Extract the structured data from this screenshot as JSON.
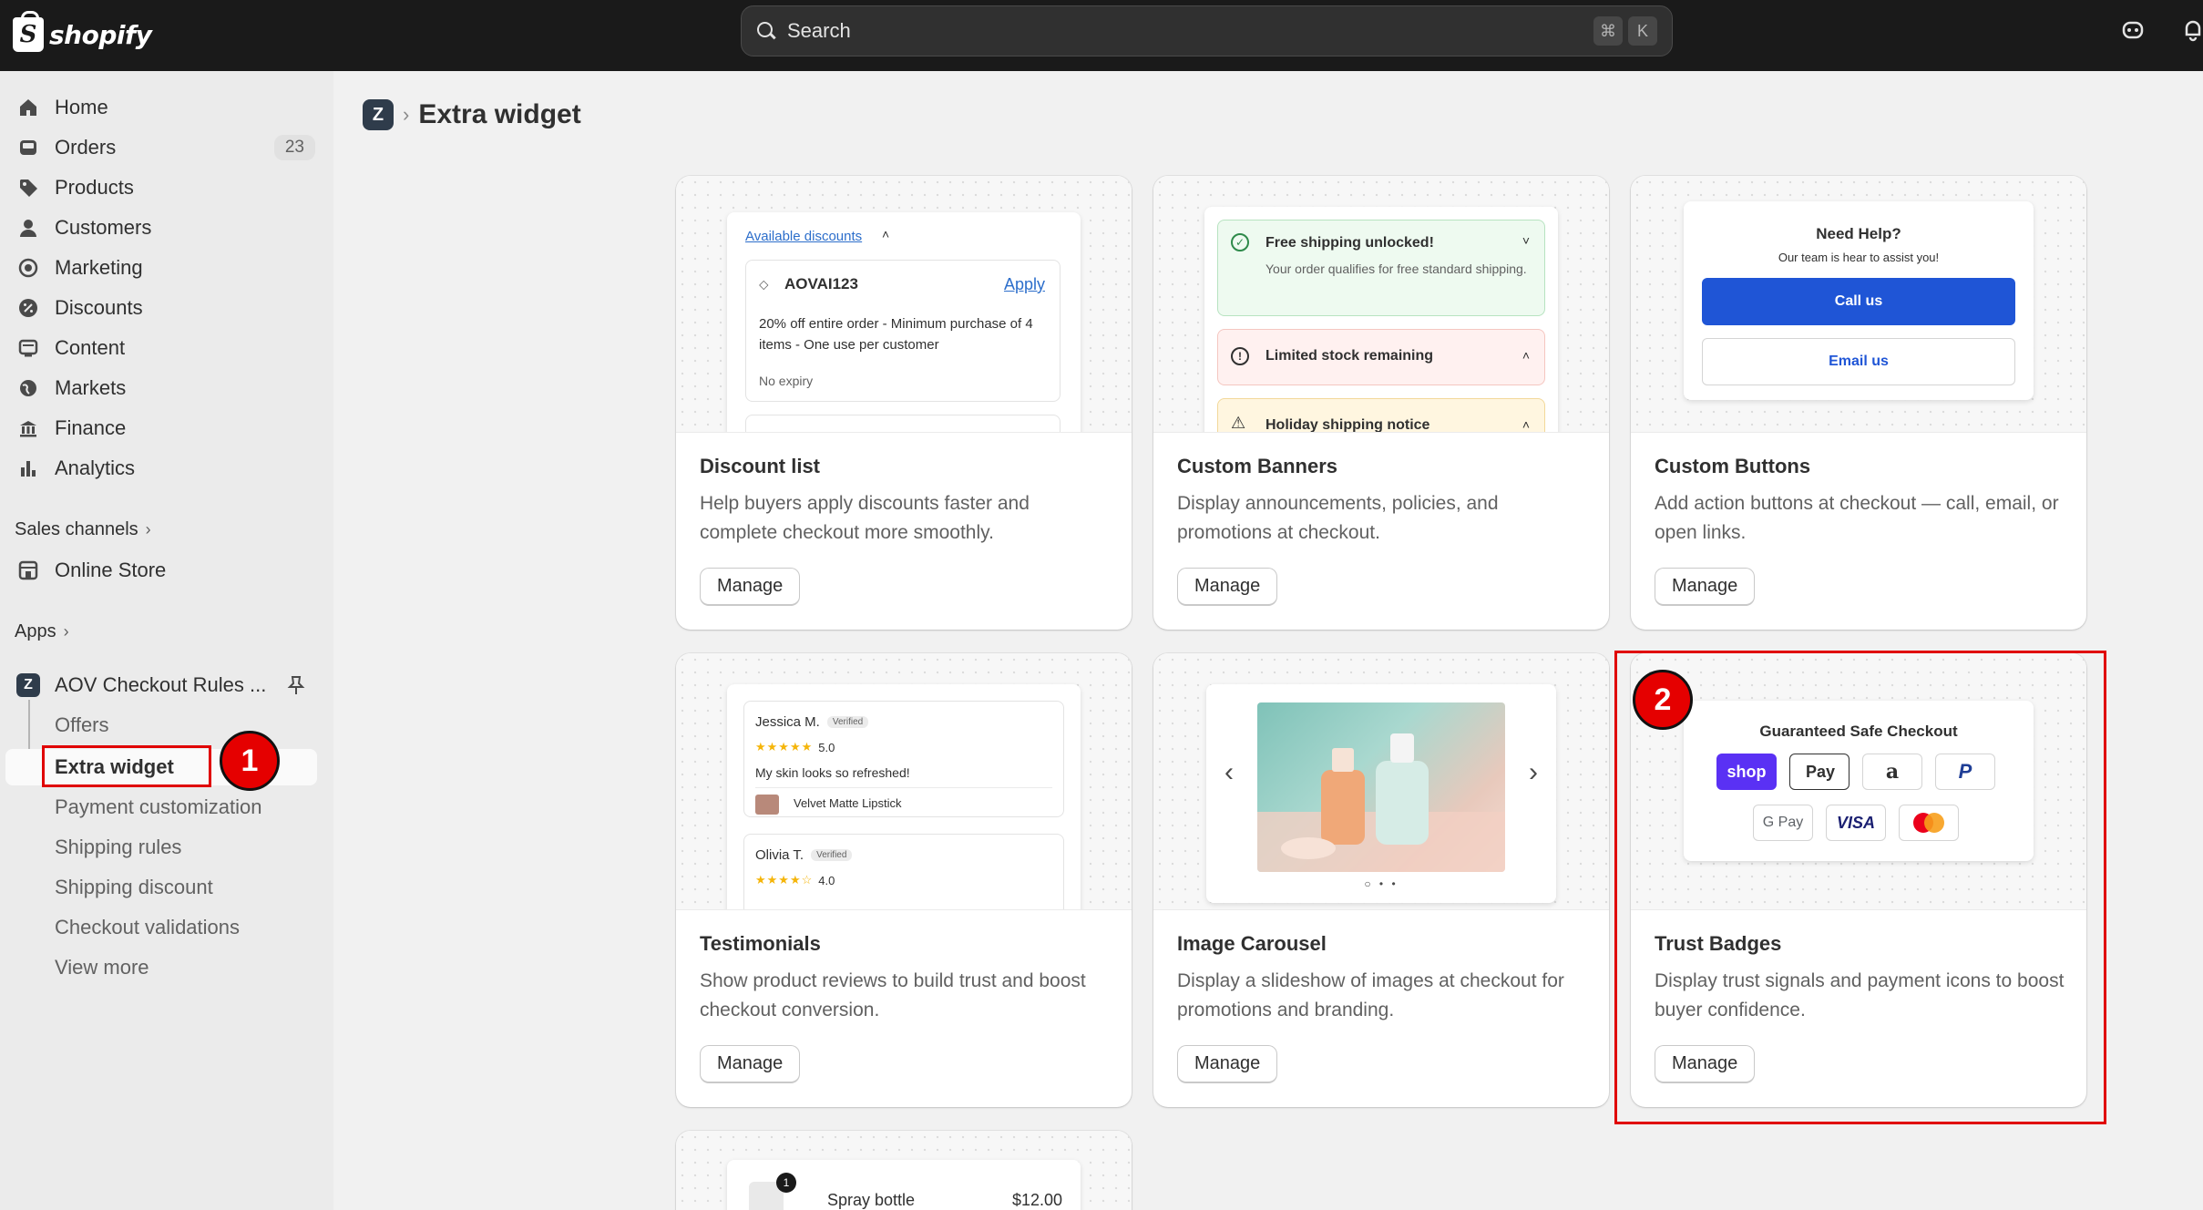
{
  "topbar": {
    "logo_text": "shopify",
    "search_placeholder": "Search",
    "shortcut_keys": [
      "⌘",
      "K"
    ],
    "icons": [
      "notification-mascot-icon",
      "bell-icon"
    ]
  },
  "sidebar": {
    "items": [
      {
        "label": "Home",
        "icon": "home-icon"
      },
      {
        "label": "Orders",
        "icon": "inbox-icon",
        "badge": "23"
      },
      {
        "label": "Products",
        "icon": "tag-icon"
      },
      {
        "label": "Customers",
        "icon": "person-icon"
      },
      {
        "label": "Marketing",
        "icon": "target-icon"
      },
      {
        "label": "Discounts",
        "icon": "discount-icon"
      },
      {
        "label": "Content",
        "icon": "content-icon"
      },
      {
        "label": "Markets",
        "icon": "globe-icon"
      },
      {
        "label": "Finance",
        "icon": "bank-icon"
      },
      {
        "label": "Analytics",
        "icon": "bar-chart-icon"
      }
    ],
    "sales_channels_label": "Sales channels",
    "online_store_label": "Online Store",
    "apps_label": "Apps",
    "app_name": "AOV Checkout Rules ...",
    "app_subitems": [
      "Offers",
      "Extra widget",
      "Payment customization",
      "Shipping rules",
      "Shipping discount",
      "Checkout validations",
      "View more"
    ]
  },
  "annotations": {
    "one": "1",
    "two": "2"
  },
  "main": {
    "title": "Extra widget",
    "cards": [
      {
        "title": "Discount list",
        "desc": "Help buyers apply discounts faster and complete checkout more smoothly.",
        "button": "Manage"
      },
      {
        "title": "Custom Banners",
        "desc": "Display announcements, policies, and promotions at checkout.",
        "button": "Manage"
      },
      {
        "title": "Custom Buttons",
        "desc": "Add action buttons at checkout — call, email, or open links.",
        "button": "Manage"
      },
      {
        "title": "Testimonials",
        "desc": "Show product reviews to build trust and boost checkout conversion.",
        "button": "Manage"
      },
      {
        "title": "Image Carousel",
        "desc": "Display a slideshow of images at checkout for promotions and branding.",
        "button": "Manage"
      },
      {
        "title": "Trust Badges",
        "desc": "Display trust signals and payment icons to boost buyer confidence.",
        "button": "Manage"
      }
    ],
    "previews": {
      "discount": {
        "header": "Available discounts",
        "code": "AOVAI123",
        "apply": "Apply",
        "detail": "20% off entire order - Minimum purchase of 4 items - One use per customer",
        "expiry": "No expiry"
      },
      "banners": {
        "b1_title": "Free shipping unlocked!",
        "b1_text": "Your order qualifies for free standard shipping.",
        "b2_title": "Limited stock remaining",
        "b3_title": "Holiday shipping notice"
      },
      "buttons": {
        "title": "Need Help?",
        "subtitle": "Our team is hear to assist you!",
        "call": "Call us",
        "email": "Email us"
      },
      "testimonials": {
        "r1_name": "Jessica M.",
        "r1_badge": "Verified",
        "r1_stars": "★★★★★",
        "r1_rating": "5.0",
        "r1_text": "My skin looks so refreshed!",
        "r1_product": "Velvet Matte Lipstick",
        "r2_name": "Olivia T.",
        "r2_badge": "Verified",
        "r2_stars": "★★★★☆",
        "r2_rating": "4.0"
      },
      "carousel": {
        "prev": "‹",
        "next": "›",
        "dots": "○ • •"
      },
      "trust": {
        "title": "Guaranteed Safe Checkout",
        "badges": [
          "shop",
          "Pay",
          "a",
          "P",
          "G Pay",
          "VISA",
          ""
        ]
      },
      "cart": {
        "badge": "1",
        "item": "Spray bottle",
        "price": "$12.00"
      }
    }
  }
}
